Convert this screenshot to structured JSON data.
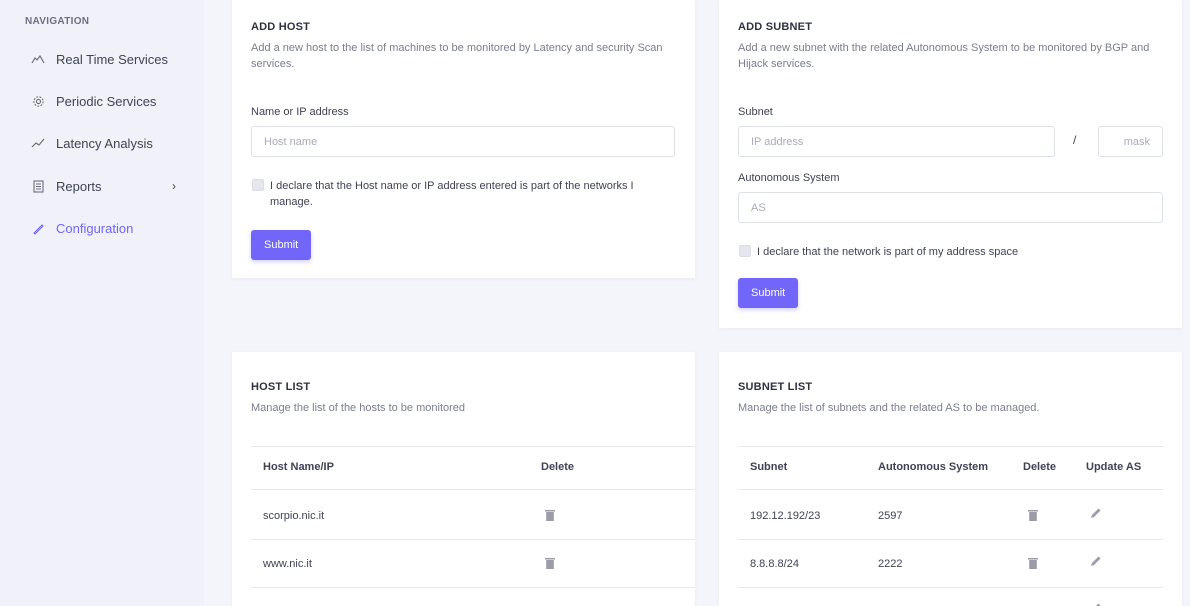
{
  "sidebar": {
    "heading": "NAVIGATION",
    "items": [
      {
        "label": "Real Time Services",
        "icon": "gauge-icon"
      },
      {
        "label": "Periodic Services",
        "icon": "gear-icon"
      },
      {
        "label": "Latency Analysis",
        "icon": "line-chart-icon"
      },
      {
        "label": "Reports",
        "icon": "document-icon",
        "chevron": "›"
      },
      {
        "label": "Configuration",
        "icon": "pencil-icon",
        "active": true
      }
    ]
  },
  "add_host": {
    "title": "ADD HOST",
    "description": "Add a new host to the list of machines to be monitored by Latency and security Scan services.",
    "field_label": "Name or IP address",
    "placeholder": "Host name",
    "value": "",
    "checkbox_label": "I declare that the Host name or IP address entered is part of the networks I manage.",
    "checked": false,
    "submit": "Submit"
  },
  "add_subnet": {
    "title": "ADD SUBNET",
    "description": "Add a new subnet with the related Autonomous System to be monitored by BGP and Hijack services.",
    "subnet_label": "Subnet",
    "ip_placeholder": "IP address",
    "separator": "/",
    "mask_placeholder": "mask",
    "as_label": "Autonomous System",
    "as_placeholder": "AS",
    "checkbox_label": "I declare that the network is part of my address space",
    "checked": false,
    "submit": "Submit"
  },
  "host_list": {
    "title": "HOST LIST",
    "description": "Manage the list of the hosts to be monitored",
    "columns": [
      "Host Name/IP",
      "Delete"
    ],
    "rows": [
      {
        "host": "scorpio.nic.it"
      },
      {
        "host": "www.nic.it"
      }
    ]
  },
  "subnet_list": {
    "title": "SUBNET LIST",
    "description": "Manage the list of subnets and the related AS to be managed.",
    "columns": [
      "Subnet",
      "Autonomous System",
      "Delete",
      "Update AS"
    ],
    "rows": [
      {
        "subnet": "192.12.192/23",
        "as": "2597"
      },
      {
        "subnet": "8.8.8.8/24",
        "as": "2222"
      }
    ]
  },
  "colors": {
    "accent": "#7166f9",
    "sidebar_bg": "#f1f2f9",
    "page_bg": "#f4f5fb"
  }
}
